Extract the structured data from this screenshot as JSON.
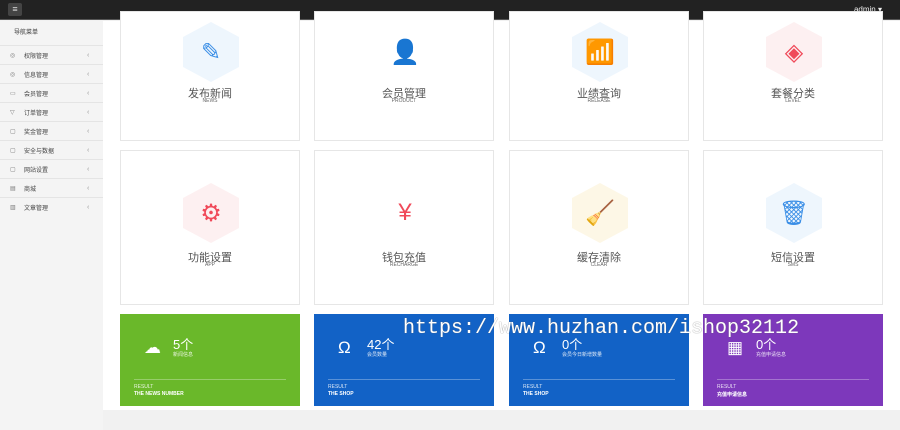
{
  "topbar": {
    "menu_icon": "list-icon",
    "user": "admin ▾"
  },
  "sidebar": {
    "title": "导航菜单",
    "items": [
      {
        "label": "权限管理",
        "icon": "◎"
      },
      {
        "label": "信息管理",
        "icon": "◎"
      },
      {
        "label": "会员管理",
        "icon": "▭"
      },
      {
        "label": "订单管理",
        "icon": "▽"
      },
      {
        "label": "奖金管理",
        "icon": "▢"
      },
      {
        "label": "安全与数据",
        "icon": "▢"
      },
      {
        "label": "网站设置",
        "icon": "▢"
      },
      {
        "label": "商城",
        "icon": "▤"
      },
      {
        "label": "文章管理",
        "icon": "▥"
      }
    ]
  },
  "tiles": [
    {
      "cn": "发布新闻",
      "en": "NEWS",
      "icon": "✎",
      "color": "#3a8ee6",
      "bg": "#eef6fd"
    },
    {
      "cn": "会员管理",
      "en": "PRODUCT",
      "icon": "👤",
      "color": "#22c064",
      "bg": "#ffffff"
    },
    {
      "cn": "业绩查询",
      "en": "RELEASE",
      "icon": "📶",
      "color": "#3a8ee6",
      "bg": "#eef6fd"
    },
    {
      "cn": "套餐分类",
      "en": "LEVEL",
      "icon": "◈",
      "color": "#f04a5a",
      "bg": "#fdf0f1"
    },
    {
      "cn": "功能设置",
      "en": "APP",
      "icon": "⚙",
      "color": "#f04a5a",
      "bg": "#fdf0f1"
    },
    {
      "cn": "钱包充值",
      "en": "RECHARGE",
      "icon": "¥",
      "color": "#f04a5a",
      "bg": "#ffffff"
    },
    {
      "cn": "缓存清除",
      "en": "CLEAR",
      "icon": "🧹",
      "color": "#f5a623",
      "bg": "#fdf7e6"
    },
    {
      "cn": "短信设置",
      "en": "SMS",
      "icon": "🗑",
      "color": "#3a8ee6",
      "bg": "#eef6fd"
    }
  ],
  "stats": [
    {
      "num": "5个",
      "desc": "新闻信息",
      "result": "RESULT",
      "sub": "THE NEWS NUMBER",
      "icon": "☁",
      "color": "#6ab82a"
    },
    {
      "num": "42个",
      "desc": "会员数量",
      "result": "RESULT",
      "sub": "THE SHOP",
      "icon": "Ω",
      "color": "#1262c6"
    },
    {
      "num": "0个",
      "desc": "会员今日新增数量",
      "result": "RESULT",
      "sub": "THE SHOP",
      "icon": "Ω",
      "color": "#1262c6"
    },
    {
      "num": "0个",
      "desc": "充值申请信息",
      "result": "RESULT",
      "sub": "充值申请信息",
      "icon": "▦",
      "color": "#7d38bb"
    }
  ],
  "watermark": "https://www.huzhan.com/ishop32112"
}
